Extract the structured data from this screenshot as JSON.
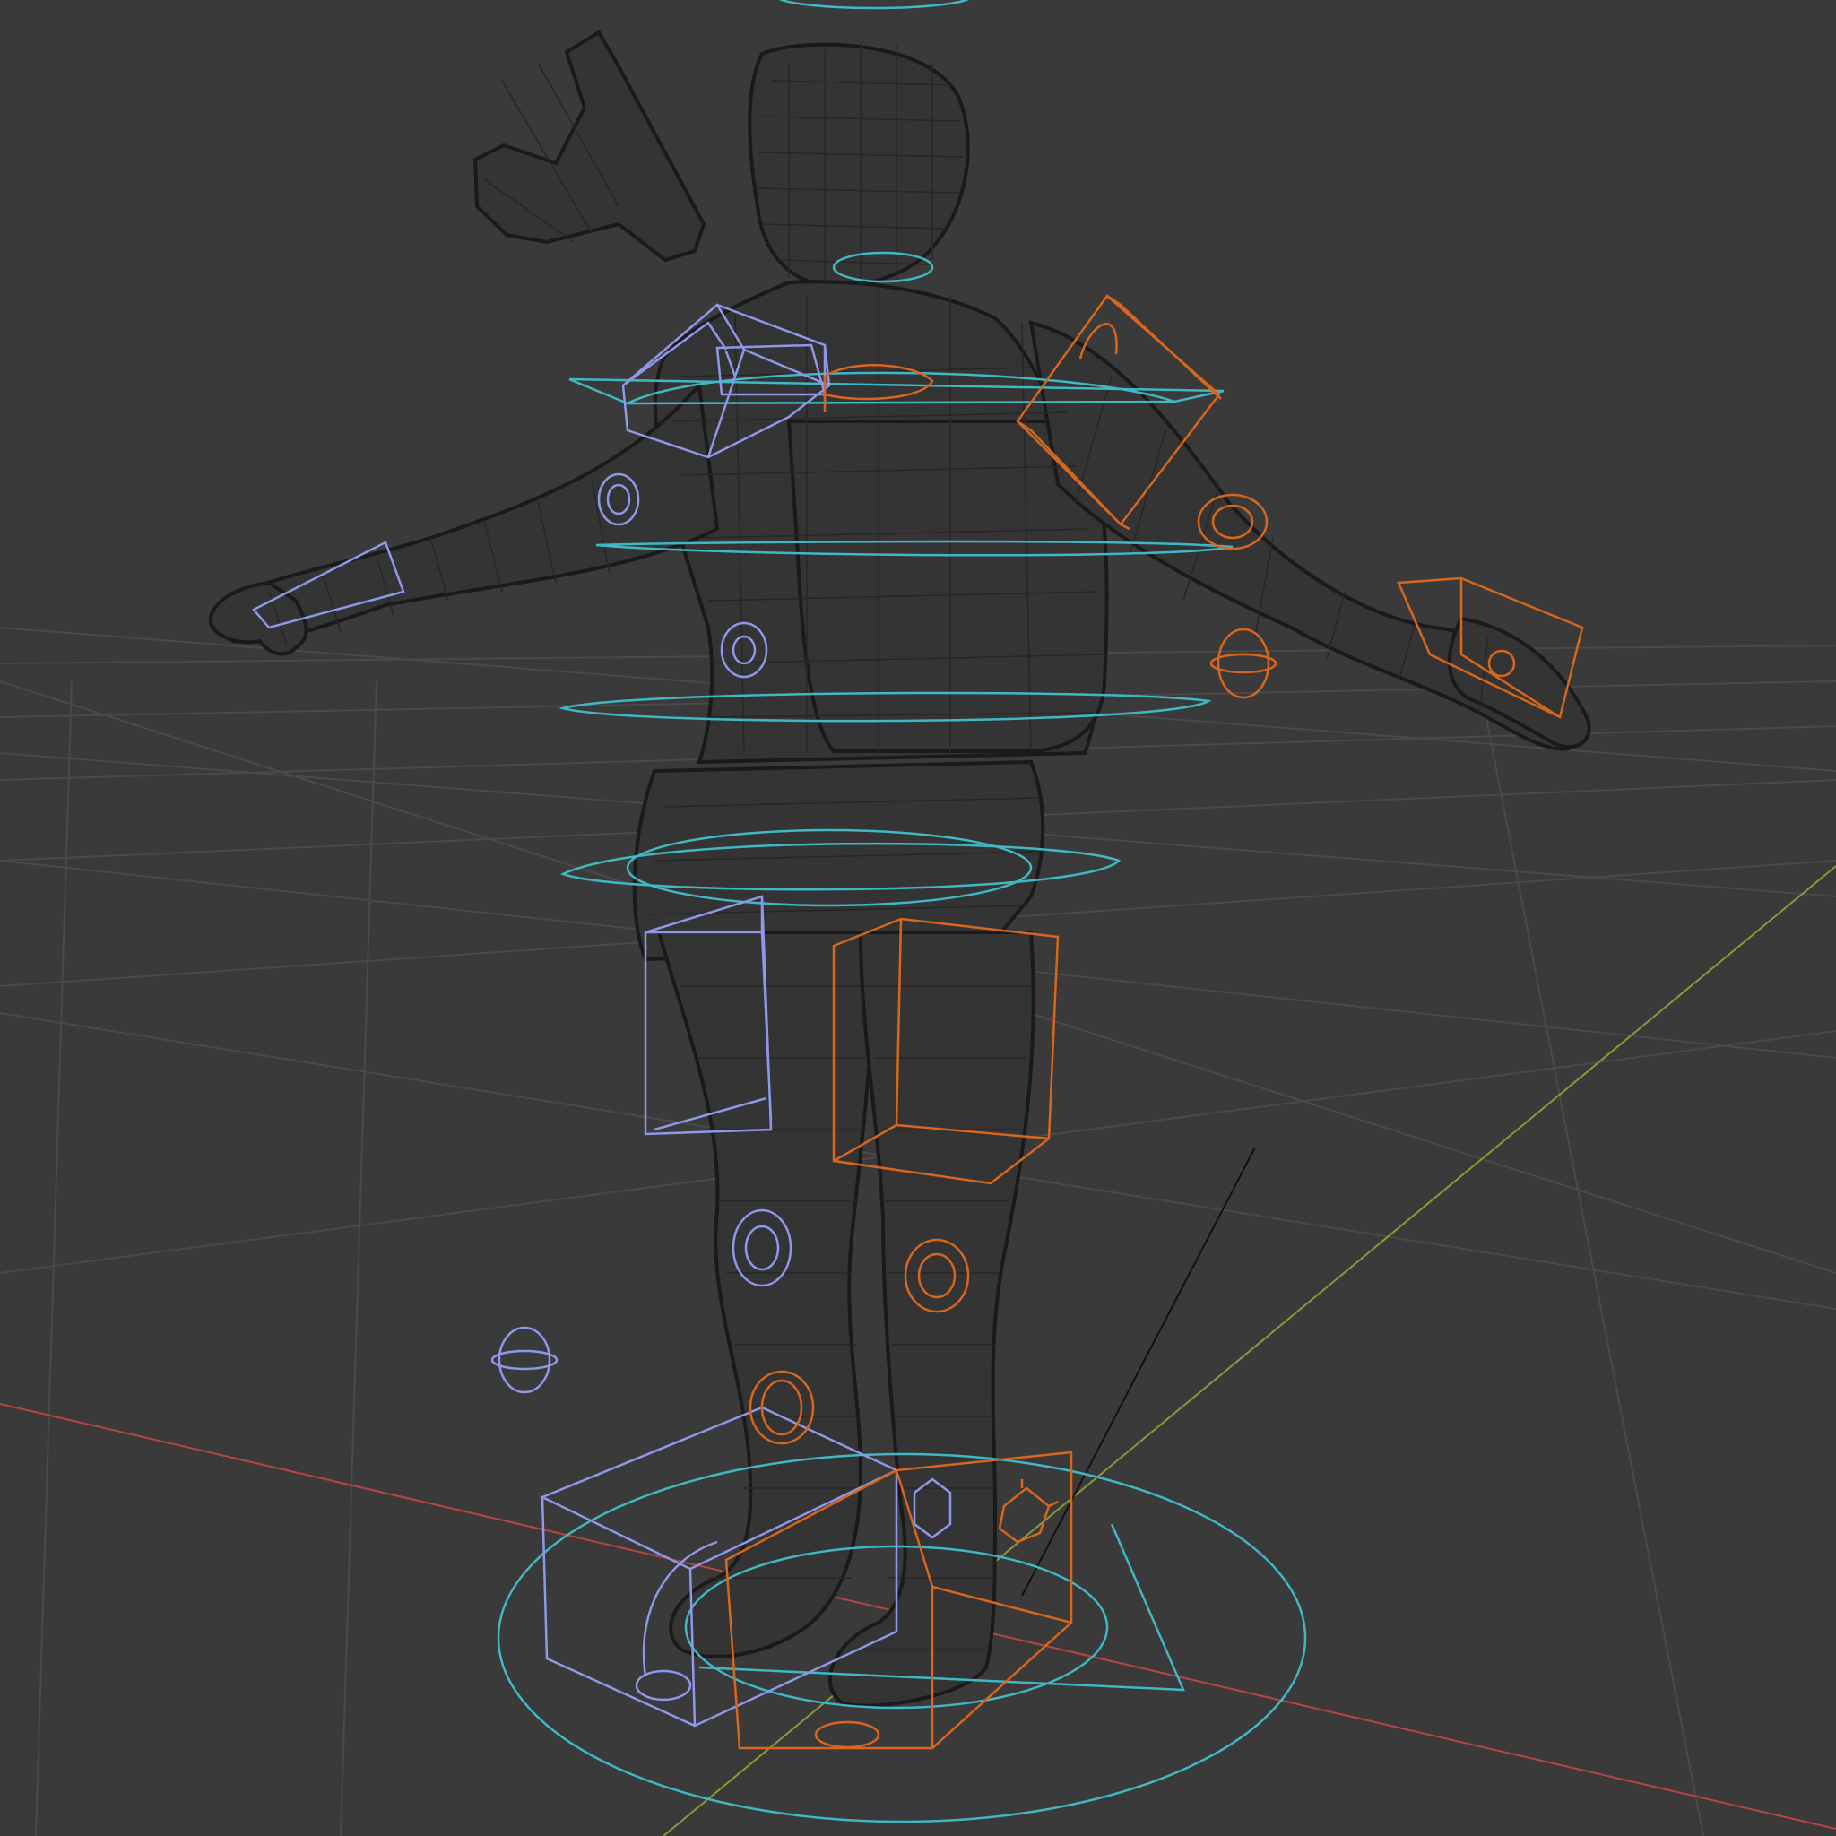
{
  "viewport": {
    "background": "#3a3a3a",
    "mode": "wireframe",
    "grid_color": "#4a4a4a",
    "x_axis_color": "#b84545",
    "y_axis_color": "#8a9a33",
    "mesh_color": "#1a1a1a",
    "control_colors": {
      "center": "#3fb8c4",
      "left": "#8f97ea",
      "right": "#d8661c"
    }
  },
  "scene": {
    "object": "character-rig",
    "icon": "armature-icon"
  }
}
